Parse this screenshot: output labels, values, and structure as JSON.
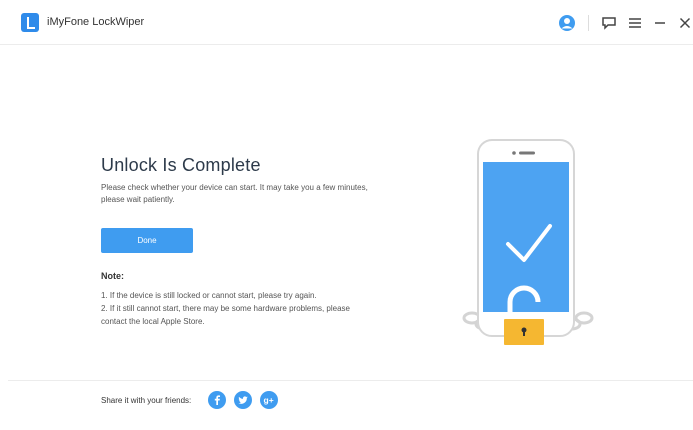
{
  "window": {
    "title": "iMyFone LockWiper"
  },
  "titlebar": {
    "icons": [
      "user-icon",
      "feedback-icon",
      "menu-icon",
      "minimize-icon",
      "close-icon"
    ],
    "accent_color": "#3f9cf0"
  },
  "main": {
    "heading": "Unlock Is Complete",
    "description": "Please check whether your device can start. It may take you a few minutes, please wait patiently.",
    "done_label": "Done",
    "note_title": "Note:",
    "notes": [
      "1. If the device is still locked or cannot start, please try again.",
      "2. If it still cannot start, there may be some hardware problems, please",
      "contact the local Apple Store."
    ]
  },
  "footer": {
    "share_label": "Share it with your friends:",
    "social": [
      "facebook-icon",
      "twitter-icon",
      "google-plus-icon"
    ],
    "social_color": "#3f9cf0"
  },
  "illustration": {
    "screen_color": "#4da3f2",
    "lock_color": "#f5b731"
  }
}
